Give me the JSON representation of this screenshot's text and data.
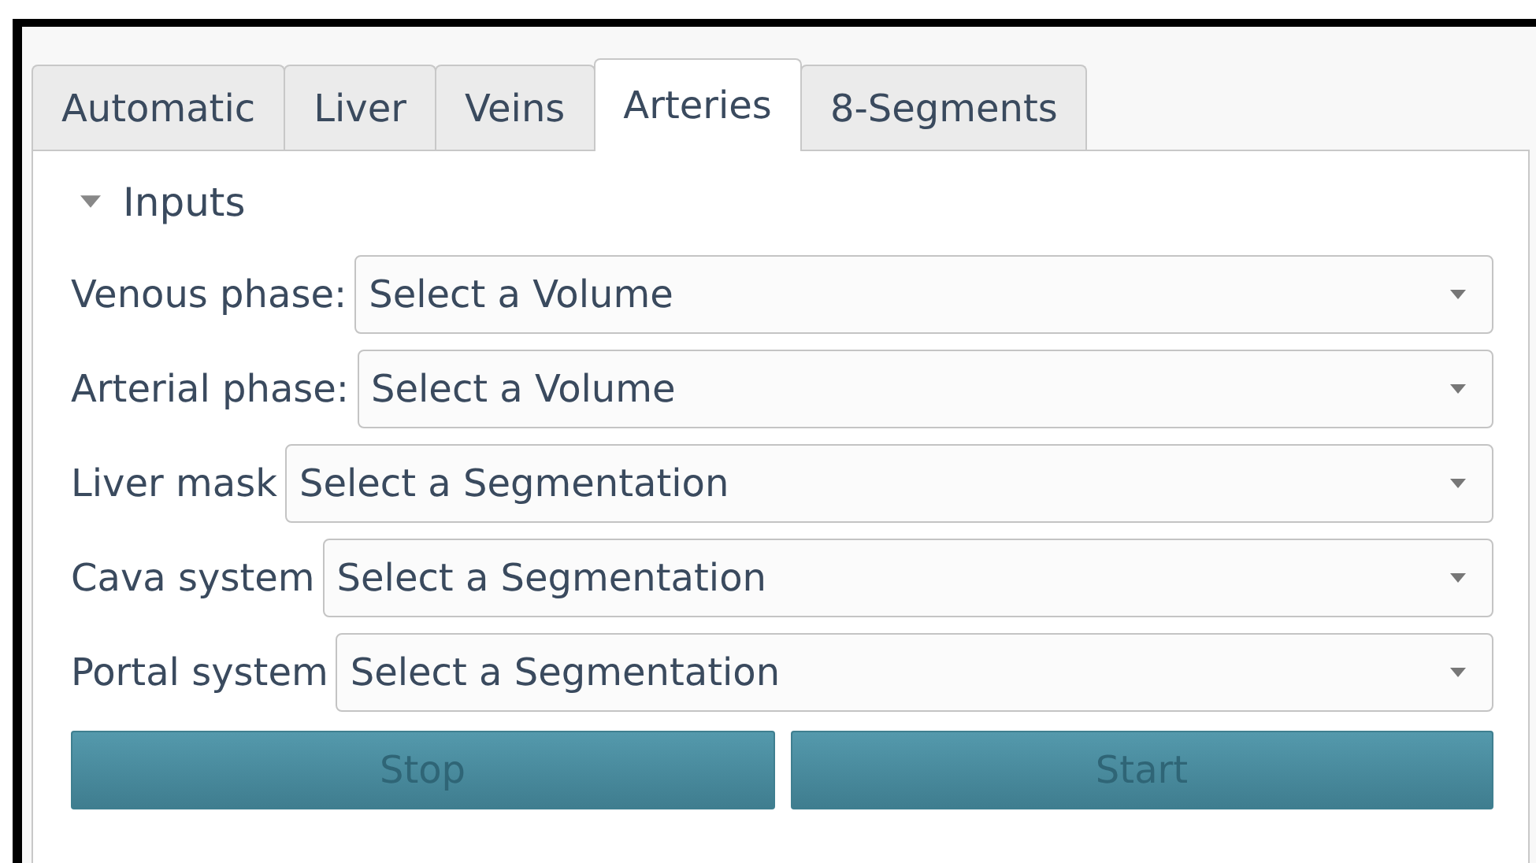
{
  "tabs": [
    {
      "label": "Automatic",
      "selected": false
    },
    {
      "label": "Liver",
      "selected": false
    },
    {
      "label": "Veins",
      "selected": false
    },
    {
      "label": "Arteries",
      "selected": true
    },
    {
      "label": "8-Segments",
      "selected": false
    }
  ],
  "section": {
    "title": "Inputs",
    "expanded": true
  },
  "inputs": [
    {
      "label": "Venous phase:",
      "value": "Select a Volume"
    },
    {
      "label": "Arterial phase:",
      "value": "Select a Volume"
    },
    {
      "label": "Liver mask",
      "value": "Select a Segmentation"
    },
    {
      "label": "Cava system",
      "value": "Select a Segmentation"
    },
    {
      "label": "Portal system",
      "value": "Select a Segmentation"
    }
  ],
  "buttons": [
    {
      "label": "Stop",
      "disabled": true
    },
    {
      "label": "Start",
      "disabled": true
    }
  ]
}
